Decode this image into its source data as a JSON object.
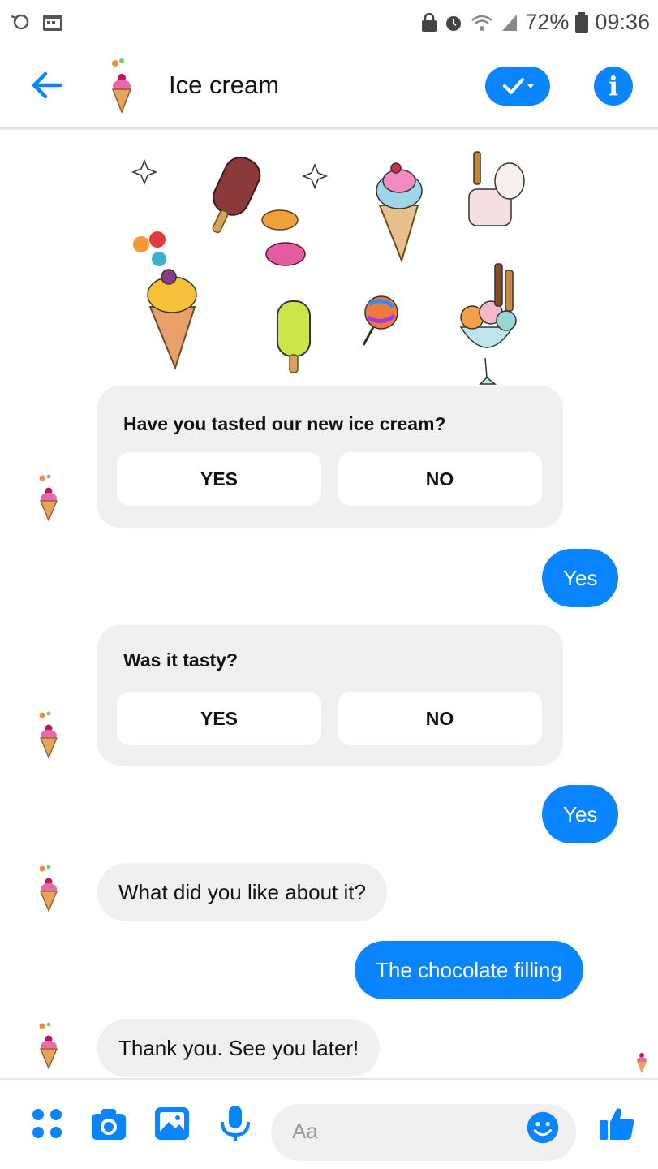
{
  "status_bar": {
    "battery": "72%",
    "time": "09:36",
    "icons": [
      "sync-icon",
      "calendar-icon",
      "lock-icon",
      "alarm-icon",
      "wifi-icon",
      "signal-icon",
      "battery-icon"
    ]
  },
  "header": {
    "title": "Ice cream",
    "icons": [
      "back-arrow-icon",
      "check-dropdown-icon",
      "info-icon"
    ],
    "accent": "#0a84ff"
  },
  "messages": {
    "card1": {
      "title": "Have you tasted our new ice cream?",
      "options": [
        "YES",
        "NO"
      ]
    },
    "reply1": "Yes",
    "card2": {
      "title": "Was it tasty?",
      "options": [
        "YES",
        "NO"
      ]
    },
    "reply2": "Yes",
    "bot3": "What did you like about it?",
    "reply3": "The chocolate filling",
    "bot4": "Thank you. See you later!"
  },
  "composer": {
    "placeholder": "Aa",
    "icons": [
      "apps-icon",
      "camera-icon",
      "gallery-icon",
      "mic-icon",
      "emoji-icon",
      "thumbs-up-icon"
    ]
  }
}
